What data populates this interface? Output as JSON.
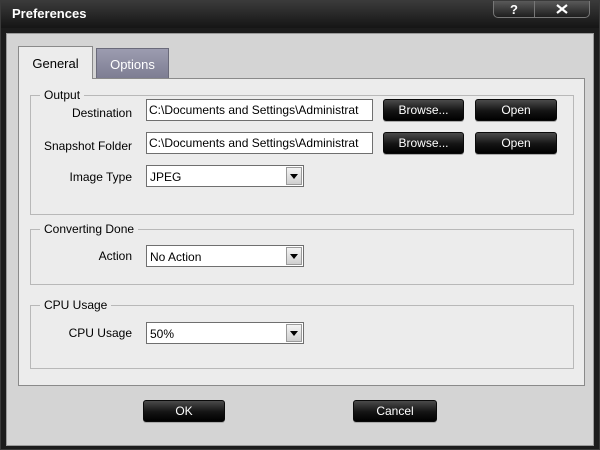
{
  "window": {
    "title": "Preferences",
    "help_label": "?",
    "close_icon": "close-x-icon"
  },
  "tabs": [
    {
      "label": "General",
      "selected": true
    },
    {
      "label": "Options",
      "selected": false
    }
  ],
  "output": {
    "title": "Output",
    "destination_label": "Destination",
    "destination_value": "C:\\Documents and Settings\\Administrat",
    "snapshot_label": "Snapshot Folder",
    "snapshot_value": "C:\\Documents and Settings\\Administrat",
    "browse_label": "Browse...",
    "open_label": "Open",
    "image_type_label": "Image Type",
    "image_type_value": "JPEG"
  },
  "converting": {
    "title": "Converting Done",
    "action_label": "Action",
    "action_value": "No Action"
  },
  "cpu": {
    "title": "CPU Usage",
    "cpu_label": "CPU Usage",
    "cpu_value": "50%"
  },
  "footer": {
    "ok_label": "OK",
    "cancel_label": "Cancel"
  },
  "colors": {
    "frame": "#1c1c1c",
    "panel": "#d4d4d4",
    "content": "#ececec",
    "inactive_tab": "#8a8aa0"
  }
}
